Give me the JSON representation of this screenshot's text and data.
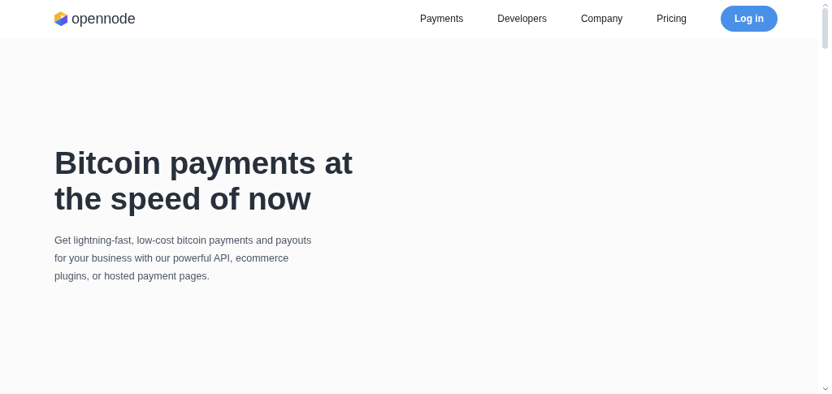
{
  "header": {
    "logo_text": "opennode",
    "nav": [
      {
        "label": "Payments"
      },
      {
        "label": "Developers"
      },
      {
        "label": "Company"
      },
      {
        "label": "Pricing"
      }
    ],
    "login_button": "Log in"
  },
  "hero": {
    "title": "Bitcoin payments at the speed of now",
    "description": "Get lightning-fast, low-cost bitcoin payments and payouts for your business with our powerful API, ecommerce plugins, or hosted payment pages."
  }
}
